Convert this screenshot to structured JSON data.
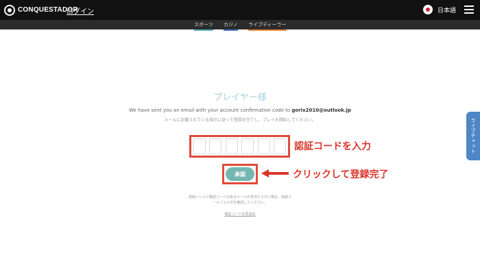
{
  "header": {
    "logo_text": "CONQUESTADOR",
    "login_label": "ログイン",
    "language_label": "日本語"
  },
  "subnav": {
    "items": [
      "スポーツ",
      "カジノ",
      "ライブディーラー"
    ]
  },
  "main": {
    "title": "プレイヤー様",
    "sent_prefix": "We have sent you an email with your account confirmation code to",
    "email": "gorix2010@outlook.jp",
    "instruction": "メールに記載されている指示に従って登録を完了し、プレイを開始してください。",
    "approve_label": "承認",
    "help_text_line1": "登録トレイに確認コードのあるメールが見当たらない場合、迷惑メ",
    "help_text_line2": "ールフォルダを確認してください。",
    "resend_label": "確認コードを再送信"
  },
  "annotations": {
    "code_annotation": "認証コードを入力",
    "click_annotation": "クリックして登録完了"
  },
  "live_chat_label": "ライブチャット",
  "colors": {
    "header_bg": "#111111",
    "title": "#a6d2dc",
    "approve_button": "#74b7b0",
    "annotation_red": "#d9362b",
    "live_chat_tab": "#4f86c6"
  }
}
